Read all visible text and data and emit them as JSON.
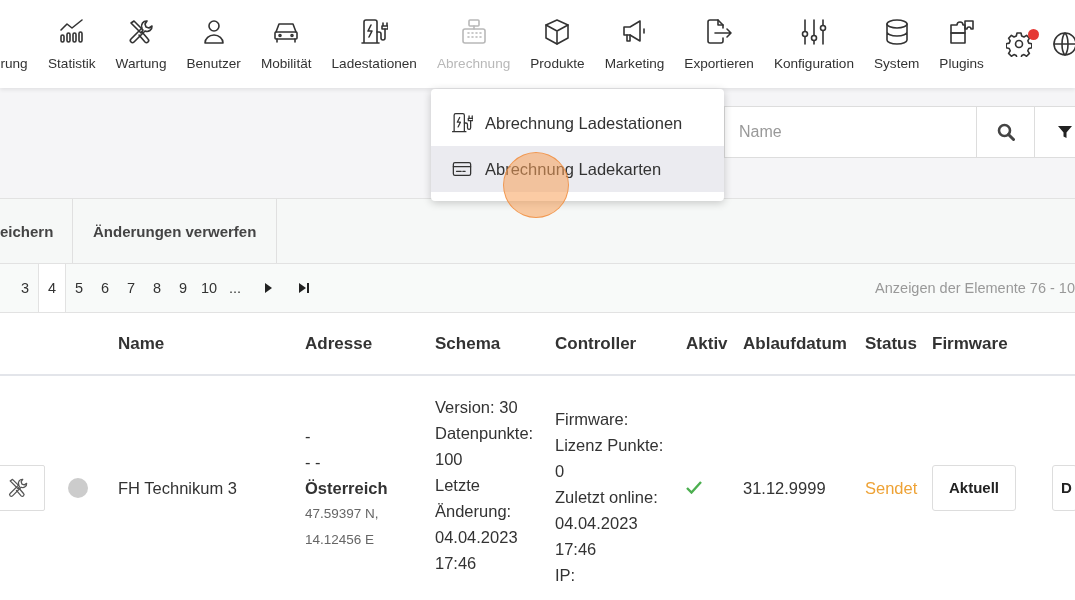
{
  "nav": {
    "items": [
      {
        "label": "rung",
        "selected": false
      },
      {
        "label": "Statistik",
        "selected": false
      },
      {
        "label": "Wartung",
        "selected": false
      },
      {
        "label": "Benutzer",
        "selected": false
      },
      {
        "label": "Mobilität",
        "selected": false
      },
      {
        "label": "Ladestationen",
        "selected": false
      },
      {
        "label": "Abrechnung",
        "selected": true
      },
      {
        "label": "Produkte",
        "selected": false
      },
      {
        "label": "Marketing",
        "selected": false
      },
      {
        "label": "Exportieren",
        "selected": false
      },
      {
        "label": "Konfiguration",
        "selected": false
      },
      {
        "label": "System",
        "selected": false
      },
      {
        "label": "Plugins",
        "selected": false
      }
    ],
    "settings": {
      "notification": true
    }
  },
  "dropdown": {
    "items": [
      {
        "label": "Abrechnung Ladestationen",
        "selected": false
      },
      {
        "label": "Abrechnung Ladekarten",
        "selected": true
      }
    ]
  },
  "search": {
    "placeholder": "Name"
  },
  "toolbar": {
    "buttons": [
      "eichern",
      "Änderungen verwerfen"
    ]
  },
  "pager": {
    "pages": [
      {
        "label": "3",
        "selected": false
      },
      {
        "label": "4",
        "selected": true
      },
      {
        "label": "5",
        "selected": false
      },
      {
        "label": "6",
        "selected": false
      },
      {
        "label": "7",
        "selected": false
      },
      {
        "label": "8",
        "selected": false
      },
      {
        "label": "9",
        "selected": false
      },
      {
        "label": "10",
        "selected": false
      },
      {
        "label": "...",
        "selected": false
      }
    ],
    "summary": "Anzeigen der Elemente 76 - 10"
  },
  "table": {
    "columns": [
      "Name",
      "Adresse",
      "Schema",
      "Controller",
      "Aktiv",
      "Ablaufdatum",
      "Status",
      "Firmware"
    ],
    "rows": [
      {
        "color": "#cccccc",
        "name": "FH Technikum 3",
        "address_lines": [
          "-",
          "- -"
        ],
        "country": "Österreich",
        "coordinates": "47.59397 N, 14.12456 E",
        "schema": [
          "Version: 30",
          "Datenpunkte: 100",
          "Letzte Änderung: 04.04.2023 17:46"
        ],
        "controller": [
          "Firmware:",
          "Lizenz Punkte: 0",
          "Zuletzt online: 04.04.2023 17:46",
          "IP:"
        ],
        "active": true,
        "expiry": "31.12.9999",
        "status": {
          "text": "Sendet",
          "color": "#eea235"
        },
        "firmware_button": "Aktuell",
        "last_button": "D"
      }
    ]
  }
}
